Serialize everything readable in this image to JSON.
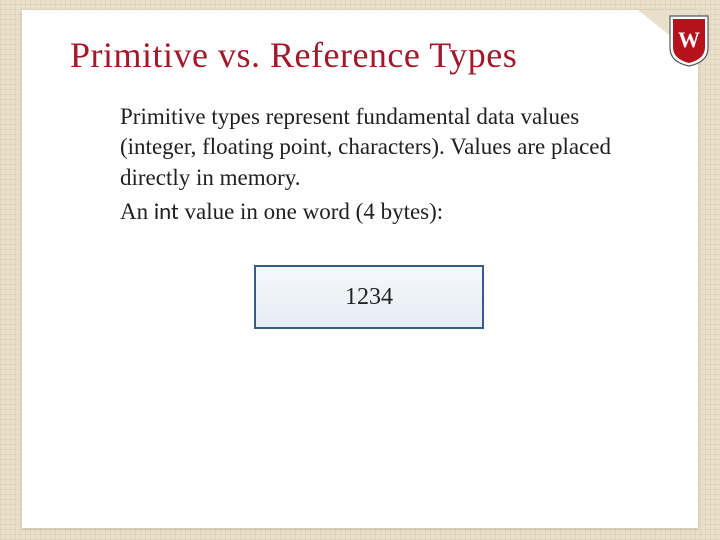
{
  "title": "Primitive vs. Reference Types",
  "paragraph1": "Primitive types represent fundamental data values (integer, floating point, characters). Values are placed directly in memory.",
  "paragraph2_prefix": "An ",
  "paragraph2_code": "int",
  "paragraph2_suffix": " value in one word (4 bytes):",
  "box_value": "1234",
  "crest_letter": "W"
}
